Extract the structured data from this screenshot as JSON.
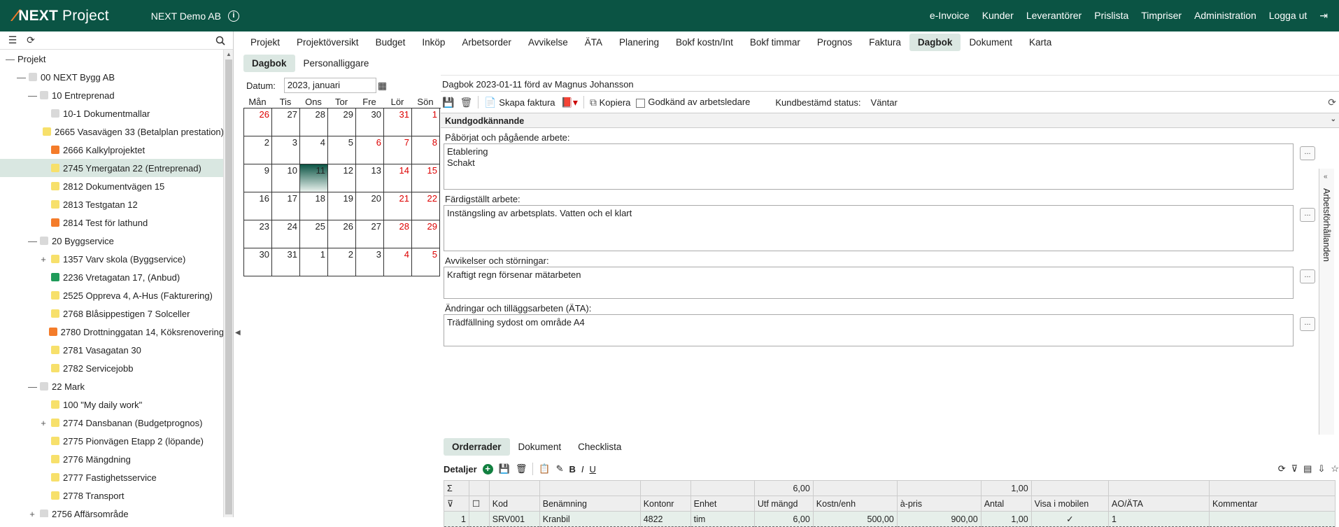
{
  "app": {
    "logo_next": "NEXT",
    "logo_project": "Project",
    "company": "NEXT Demo AB",
    "info_icon": "i"
  },
  "topnav": [
    "e-Invoice",
    "Kunder",
    "Leverantörer",
    "Prislista",
    "Timpriser",
    "Administration",
    "Logga ut"
  ],
  "tree": [
    {
      "label": "Projekt",
      "level": 0,
      "tog": "—",
      "color": ""
    },
    {
      "label": "00 NEXT Bygg AB",
      "level": 1,
      "tog": "—",
      "color": "#d9d9d9"
    },
    {
      "label": "10 Entreprenad",
      "level": 2,
      "tog": "—",
      "color": "#d9d9d9"
    },
    {
      "label": "10-1 Dokumentmallar",
      "level": 3,
      "tog": "",
      "color": "#d9d9d9"
    },
    {
      "label": "2665 Vasavägen 33 (Betalplan prestation)",
      "level": 3,
      "tog": "",
      "color": "#f7e06b"
    },
    {
      "label": "2666 Kalkylprojektet",
      "level": 3,
      "tog": "",
      "color": "#f47c2a"
    },
    {
      "label": "2745 Ymergatan 22 (Entreprenad)",
      "level": 3,
      "tog": "",
      "color": "#f7e06b",
      "selected": true
    },
    {
      "label": "2812 Dokumentvägen 15",
      "level": 3,
      "tog": "",
      "color": "#f7e06b"
    },
    {
      "label": "2813 Testgatan 12",
      "level": 3,
      "tog": "",
      "color": "#f7e06b"
    },
    {
      "label": "2814 Test för lathund",
      "level": 3,
      "tog": "",
      "color": "#f47c2a"
    },
    {
      "label": "20 Byggservice",
      "level": 2,
      "tog": "—",
      "color": "#d9d9d9"
    },
    {
      "label": "1357 Varv skola (Byggservice)",
      "level": 3,
      "tog": "+",
      "color": "#f7e06b"
    },
    {
      "label": "2236 Vretagatan 17, (Anbud)",
      "level": 3,
      "tog": "",
      "color": "#1f9b5a"
    },
    {
      "label": "2525 Oppreva 4, A-Hus (Fakturering)",
      "level": 3,
      "tog": "",
      "color": "#f7e06b"
    },
    {
      "label": "2768 Blåsippestigen 7 Solceller",
      "level": 3,
      "tog": "",
      "color": "#f7e06b"
    },
    {
      "label": "2780 Drottninggatan 14, Köksrenovering",
      "level": 3,
      "tog": "",
      "color": "#f47c2a"
    },
    {
      "label": "2781 Vasagatan 30",
      "level": 3,
      "tog": "",
      "color": "#f7e06b"
    },
    {
      "label": "2782 Servicejobb",
      "level": 3,
      "tog": "",
      "color": "#f7e06b"
    },
    {
      "label": "22 Mark",
      "level": 2,
      "tog": "—",
      "color": "#d9d9d9"
    },
    {
      "label": "100 \"My daily work\"",
      "level": 3,
      "tog": "",
      "color": "#f7e06b"
    },
    {
      "label": "2774 Dansbanan (Budgetprognos)",
      "level": 3,
      "tog": "+",
      "color": "#f7e06b"
    },
    {
      "label": "2775 Pionvägen Etapp 2 (löpande)",
      "level": 3,
      "tog": "",
      "color": "#f7e06b"
    },
    {
      "label": "2776 Mängdning",
      "level": 3,
      "tog": "",
      "color": "#f7e06b"
    },
    {
      "label": "2777 Fastighetsservice",
      "level": 3,
      "tog": "",
      "color": "#f7e06b"
    },
    {
      "label": "2778 Transport",
      "level": 3,
      "tog": "",
      "color": "#f7e06b"
    },
    {
      "label": "2756 Affärsområde",
      "level": 2,
      "tog": "+",
      "color": "#d9d9d9"
    }
  ],
  "tabs": [
    "Projekt",
    "Projektöversikt",
    "Budget",
    "Inköp",
    "Arbetsorder",
    "Avvikelse",
    "ÄTA",
    "Planering",
    "Bokf kostn/Int",
    "Bokf timmar",
    "Prognos",
    "Faktura",
    "Dagbok",
    "Dokument",
    "Karta"
  ],
  "active_tab": "Dagbok",
  "subtabs": [
    "Dagbok",
    "Personalliggare"
  ],
  "active_subtab": "Dagbok",
  "datum": {
    "label": "Datum:",
    "value": "2023, januari"
  },
  "calendar": {
    "weekdays": [
      "Mån",
      "Tis",
      "Ons",
      "Tor",
      "Fre",
      "Lör",
      "Sön"
    ],
    "weeks": [
      [
        {
          "d": "26",
          "red": true
        },
        {
          "d": "27"
        },
        {
          "d": "28"
        },
        {
          "d": "29"
        },
        {
          "d": "30"
        },
        {
          "d": "31",
          "red": true
        },
        {
          "d": "1",
          "red": true
        }
      ],
      [
        {
          "d": "2"
        },
        {
          "d": "3"
        },
        {
          "d": "4"
        },
        {
          "d": "5"
        },
        {
          "d": "6",
          "red": true
        },
        {
          "d": "7",
          "red": true
        },
        {
          "d": "8",
          "red": true
        }
      ],
      [
        {
          "d": "9"
        },
        {
          "d": "10"
        },
        {
          "d": "11",
          "today": true
        },
        {
          "d": "12"
        },
        {
          "d": "13"
        },
        {
          "d": "14",
          "red": true
        },
        {
          "d": "15",
          "red": true
        }
      ],
      [
        {
          "d": "16"
        },
        {
          "d": "17"
        },
        {
          "d": "18"
        },
        {
          "d": "19"
        },
        {
          "d": "20"
        },
        {
          "d": "21",
          "red": true
        },
        {
          "d": "22",
          "red": true
        }
      ],
      [
        {
          "d": "23"
        },
        {
          "d": "24"
        },
        {
          "d": "25"
        },
        {
          "d": "26"
        },
        {
          "d": "27"
        },
        {
          "d": "28",
          "red": true
        },
        {
          "d": "29",
          "red": true
        }
      ],
      [
        {
          "d": "30"
        },
        {
          "d": "31"
        },
        {
          "d": "1"
        },
        {
          "d": "2"
        },
        {
          "d": "3"
        },
        {
          "d": "4",
          "red": true
        },
        {
          "d": "5",
          "red": true
        }
      ]
    ]
  },
  "panel": {
    "title": "Dagbok 2023-01-11 förd av Magnus Johansson",
    "skapa_faktura": "Skapa faktura",
    "kopiera": "Kopiera",
    "godkand": "Godkänd av arbetsledare",
    "kund_status_label": "Kundbestämd status:",
    "kund_status_value": "Väntar",
    "section": "Kundgodkännande",
    "sidetab": "Arbetsförhållanden",
    "dots": "...",
    "fields": [
      {
        "label": "Påbörjat och pågående arbete:",
        "value": "Etablering\nSchakt"
      },
      {
        "label": "Färdigställt arbete:",
        "value": "Instängsling av arbetsplats. Vatten och el klart"
      },
      {
        "label": "Avvikelser och störningar:",
        "value": "Kraftigt regn försenar mätarbeten"
      },
      {
        "label": "Ändringar och tilläggsarbeten (ÄTA):",
        "value": "Trädfällning sydost om område A4"
      }
    ]
  },
  "bottomtabs": [
    "Orderrader",
    "Dokument",
    "Checklista"
  ],
  "active_bottomtab": "Orderrader",
  "details": {
    "label": "Detaljer"
  },
  "table": {
    "sum_row": [
      "",
      "",
      "",
      "",
      "",
      "",
      "6,00",
      "",
      "",
      "1,00",
      "",
      "",
      ""
    ],
    "headers": [
      "",
      "",
      "Kod",
      "Benämning",
      "Kontonr",
      "Enhet",
      "Utf mängd",
      "Kostn/enh",
      "à-pris",
      "Antal",
      "Visa i mobilen",
      "AO/ÄTA",
      "Kommentar"
    ],
    "rows": [
      [
        "1",
        "",
        "SRV001",
        "Kranbil",
        "4822",
        "tim",
        "6,00",
        "500,00",
        "900,00",
        "1,00",
        "✓",
        "1",
        ""
      ]
    ]
  }
}
